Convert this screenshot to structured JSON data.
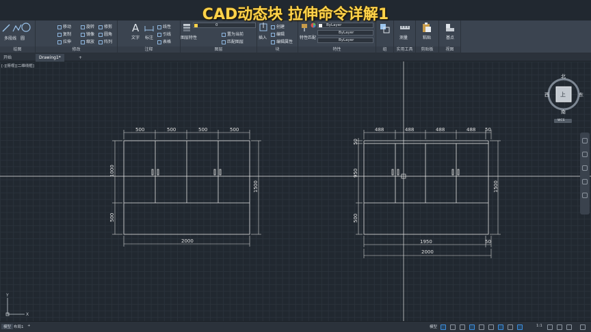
{
  "video_title": "CAD动态块 拉伸命令详解1",
  "ribbon": {
    "panels": [
      {
        "title": "绘图",
        "items": [
          "直线",
          "多段线",
          "圆",
          "圆弧"
        ]
      },
      {
        "title": "修改",
        "items": [
          "移动",
          "旋转",
          "修剪",
          "复制",
          "镜像",
          "圆角",
          "拉伸",
          "缩放",
          "阵列"
        ]
      },
      {
        "title": "注释",
        "items": [
          "文字",
          "标注",
          "线性",
          "引线",
          "表格"
        ]
      },
      {
        "title": "图层",
        "items": [
          "图层特性",
          "置为当前",
          "匹配图层"
        ],
        "layer_value": "0"
      },
      {
        "title": "块",
        "items": [
          "插入",
          "创建",
          "编辑",
          "编辑属性"
        ]
      },
      {
        "title": "特性",
        "items": [
          "特性匹配"
        ],
        "bylayer": [
          "ByLayer",
          "ByLayer",
          "ByLayer"
        ]
      },
      {
        "title": "组",
        "items": [
          "组"
        ]
      },
      {
        "title": "实用工具",
        "items": [
          "测量"
        ]
      },
      {
        "title": "剪贴板",
        "items": [
          "粘贴"
        ]
      },
      {
        "title": "视图",
        "items": [
          "基点"
        ]
      }
    ]
  },
  "tabs": [
    {
      "label": "开始",
      "active": false
    },
    {
      "label": "Drawing1*",
      "active": true
    },
    {
      "label": "+",
      "active": false
    }
  ],
  "viewport_label": "[-][俯视][二维线框]",
  "viewcube": {
    "north": "北",
    "south": "南",
    "east": "东",
    "west": "西",
    "top": "上",
    "wcs": "WCS"
  },
  "drawing_left": {
    "dims_top": [
      "500",
      "500",
      "500",
      "500"
    ],
    "dim_left_upper": "1000",
    "dim_left_lower": "500",
    "dim_right": "1500",
    "dim_bottom": "2000"
  },
  "drawing_right": {
    "dims_top": [
      "488",
      "488",
      "488",
      "488",
      "50"
    ],
    "dim_left_top": "50",
    "dim_left_upper": "950",
    "dim_left_lower": "500",
    "dim_right": "1500",
    "dim_bottom_inner": "1950",
    "dim_bottom_inner_right": "50",
    "dim_bottom": "2000"
  },
  "status": {
    "model_tab": "模型",
    "layout_tab": "布局1",
    "add_tab": "+",
    "model_label": "模型",
    "scale": "1:1"
  },
  "colors": {
    "background": "#212830",
    "ribbon": "#3b4450",
    "line": "#e6e6e6",
    "title": "#ffd34a",
    "accent": "#3d8fe0"
  }
}
